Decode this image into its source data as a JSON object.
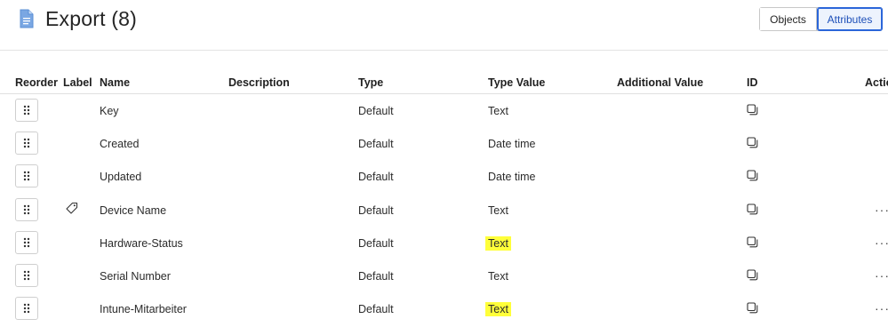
{
  "header": {
    "title": "Export (8)",
    "doc_icon": "document-icon",
    "view_toggle": {
      "objects_label": "Objects",
      "attributes_label": "Attributes",
      "selected": "Attributes"
    }
  },
  "table": {
    "columns": {
      "reorder": "Reorder",
      "label": "Label",
      "name": "Name",
      "description": "Description",
      "type": "Type",
      "type_value": "Type Value",
      "additional_value": "Additional Value",
      "id": "ID",
      "actions": "Actio"
    },
    "rows": [
      {
        "name": "Key",
        "type": "Default",
        "type_value": "Text",
        "label_icon": false,
        "actions": false,
        "highlight": false
      },
      {
        "name": "Created",
        "type": "Default",
        "type_value": "Date time",
        "label_icon": false,
        "actions": false,
        "highlight": false
      },
      {
        "name": "Updated",
        "type": "Default",
        "type_value": "Date time",
        "label_icon": false,
        "actions": false,
        "highlight": false
      },
      {
        "name": "Device Name",
        "type": "Default",
        "type_value": "Text",
        "label_icon": true,
        "actions": true,
        "highlight": false
      },
      {
        "name": "Hardware-Status",
        "type": "Default",
        "type_value": "Text",
        "label_icon": false,
        "actions": true,
        "highlight": true
      },
      {
        "name": "Serial Number",
        "type": "Default",
        "type_value": "Text",
        "label_icon": false,
        "actions": true,
        "highlight": false
      },
      {
        "name": "Intune-Mitarbeiter",
        "type": "Default",
        "type_value": "Text",
        "label_icon": false,
        "actions": true,
        "highlight": true
      }
    ],
    "more_actions_glyph": "···"
  },
  "colors": {
    "accent": "#2b66d9",
    "highlight": "#ffff3a",
    "doc_icon": "#5b8fd6"
  }
}
